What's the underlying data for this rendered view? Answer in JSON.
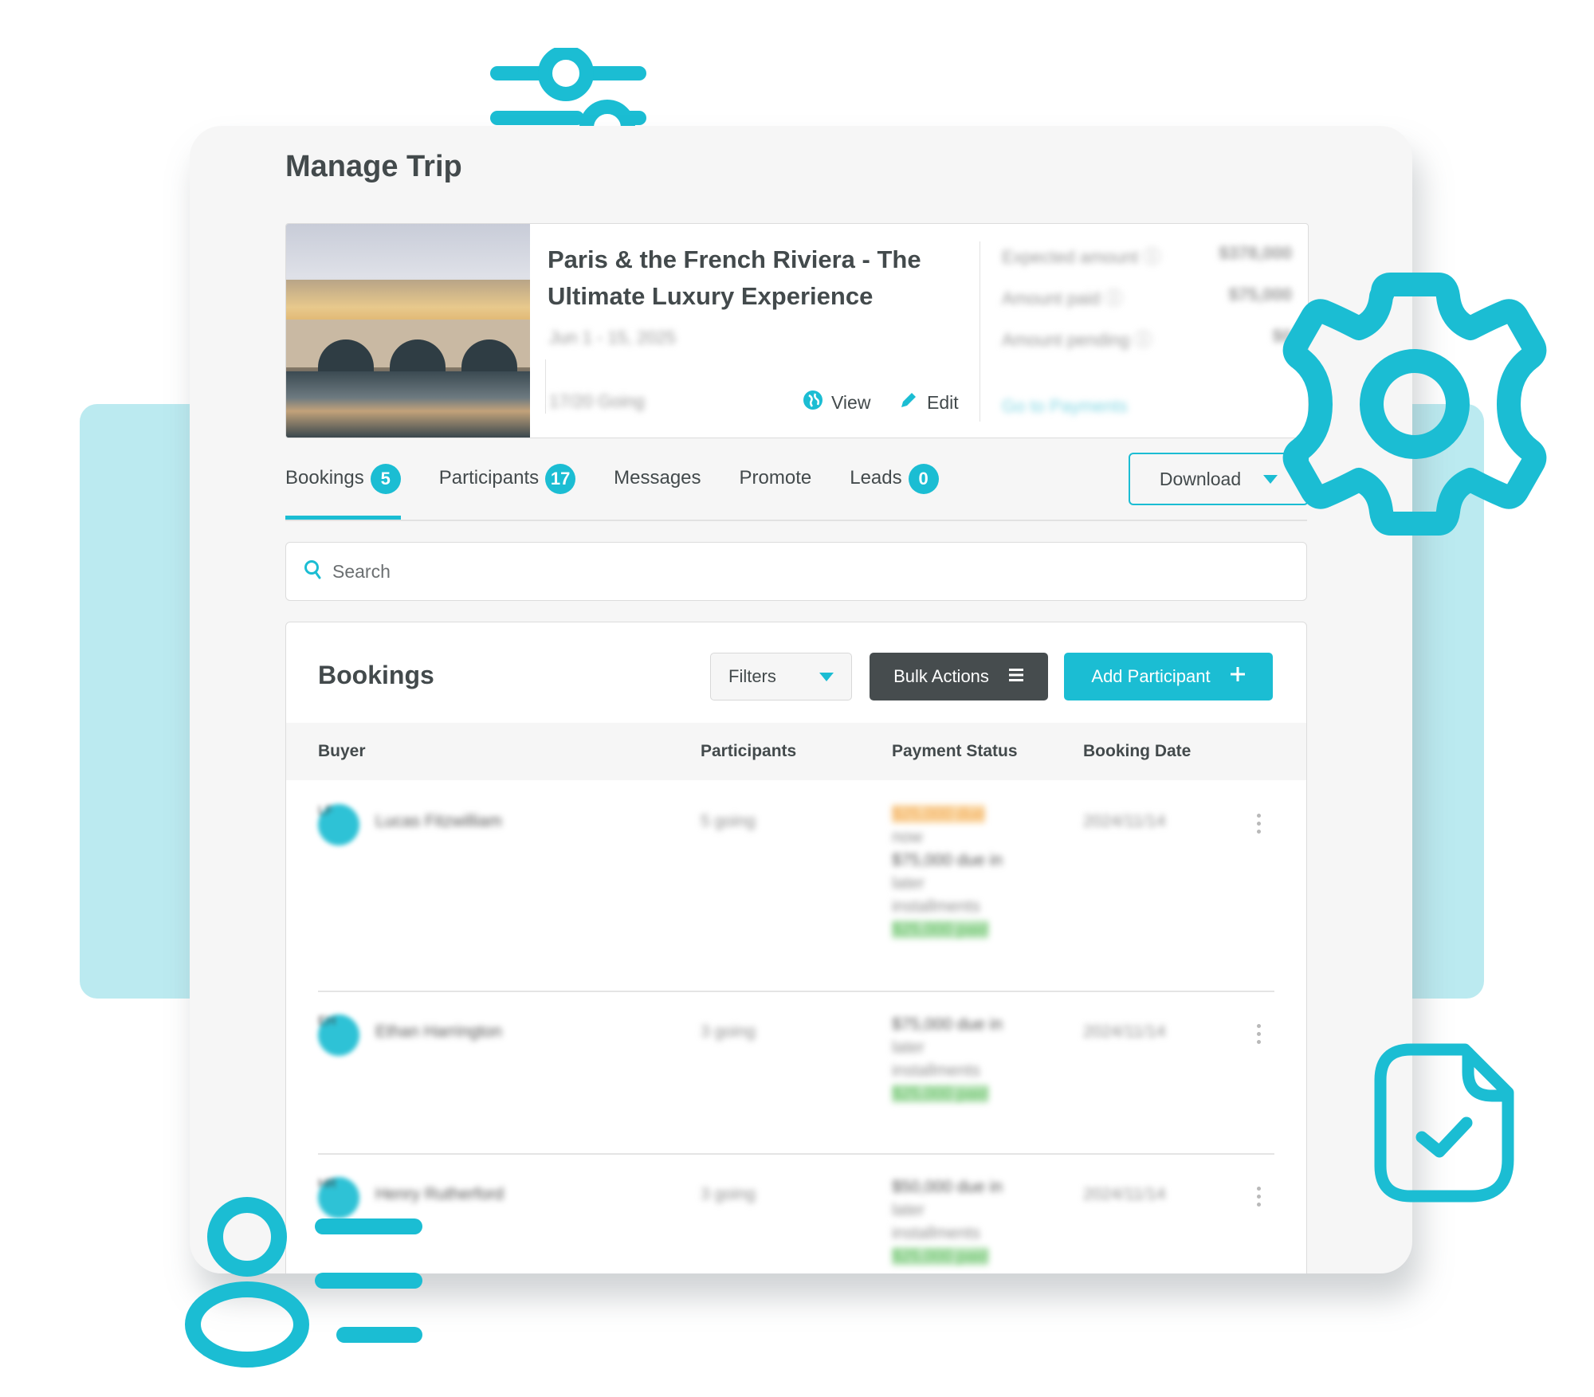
{
  "colors": {
    "accent": "#1bbdd3",
    "dark_button": "#464c4e",
    "text": "#434a4c",
    "teal_light": "#bbeaf0",
    "pending": "#f0a853",
    "paid": "#5dbd5d"
  },
  "page": {
    "title": "Manage Trip"
  },
  "trip": {
    "title": "Paris & the French Riviera - The Ultimate Luxury Experience",
    "dates": "Jun 1 - 15, 2025",
    "going": "17/20 Going",
    "actions": {
      "view": "View",
      "edit": "Edit"
    },
    "stats": [
      {
        "label": "Expected amount ⓘ",
        "value": "$378,000"
      },
      {
        "label": "Amount paid ⓘ",
        "value": "$75,000"
      },
      {
        "label": "Amount pending ⓘ",
        "value": "$0"
      }
    ],
    "payments_link": "Go to Payments"
  },
  "tabs": [
    {
      "label": "Bookings",
      "badge": "5",
      "active": true
    },
    {
      "label": "Participants",
      "badge": "17"
    },
    {
      "label": "Messages"
    },
    {
      "label": "Promote"
    },
    {
      "label": "Leads",
      "badge": "0"
    }
  ],
  "download": {
    "label": "Download"
  },
  "search": {
    "placeholder": "Search"
  },
  "bookings": {
    "title": "Bookings",
    "filters_label": "Filters",
    "bulk_actions_label": "Bulk Actions",
    "add_participant_label": "Add Participant",
    "columns": [
      "Buyer",
      "Participants",
      "Payment Status",
      "Booking Date"
    ],
    "rows": [
      {
        "initials": "LF",
        "buyer": "Lucas Fitzwilliam",
        "participants": "5 going",
        "payment": [
          "$25,000 due",
          "now",
          "$75,000 due in",
          "later",
          "installments",
          "$25,000 paid"
        ],
        "date": "2024/11/14"
      },
      {
        "initials": "EH",
        "buyer": "Ethan Harrington",
        "participants": "3 going",
        "payment": [
          "$75,000 due in",
          "later",
          "installments",
          "$25,000 paid"
        ],
        "date": "2024/11/14"
      },
      {
        "initials": "HR",
        "buyer": "Henry Rutherford",
        "participants": "3 going",
        "payment": [
          "$50,000 due in",
          "later",
          "installments",
          "$25,000 paid"
        ],
        "date": "2024/11/14"
      }
    ]
  },
  "icons": {
    "sliders": "sliders-icon",
    "gear": "gear-icon",
    "document_check": "document-check-icon",
    "user_list": "user-list-icon"
  }
}
